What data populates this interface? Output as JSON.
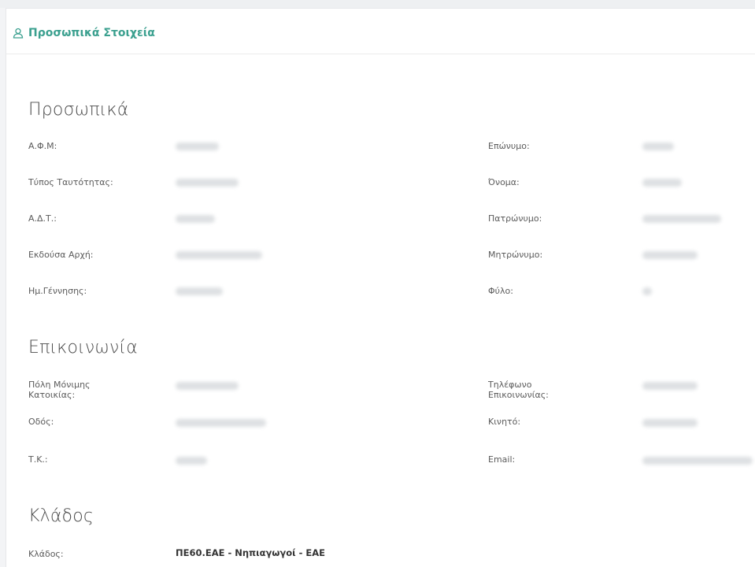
{
  "header": {
    "title": "Προσωπικά Στοιχεία",
    "icon": "user-icon"
  },
  "sections": {
    "personal": {
      "title": "Προσωπικά",
      "left": [
        "Α.Φ.Μ:",
        "Τύπος Ταυτότητας:",
        "Α.Δ.Τ.:",
        "Εκδούσα Αρχή:",
        "Ημ.Γέννησης:"
      ],
      "right": [
        "Επώνυμο:",
        "Όνομα:",
        "Πατρώνυμο:",
        "Μητρώνυμο:",
        "Φύλο:"
      ]
    },
    "contact": {
      "title": "Επικοινωνία",
      "left": [
        "Πόλη Μόνιμης\nΚατοικίας:",
        "Οδός:",
        "Τ.Κ.:"
      ],
      "right": [
        "Τηλέφωνο\nΕπικοινωνίας:",
        "Κινητό:",
        "Email:"
      ]
    },
    "branch": {
      "title": "Κλάδος",
      "label": "Κλάδος:",
      "value": "ΠΕ60.ΕΑΕ - Νηπιαγωγοί - ΕΑΕ"
    }
  },
  "colors": {
    "accent": "#3ba08f",
    "redacted": "#d8dbde"
  }
}
